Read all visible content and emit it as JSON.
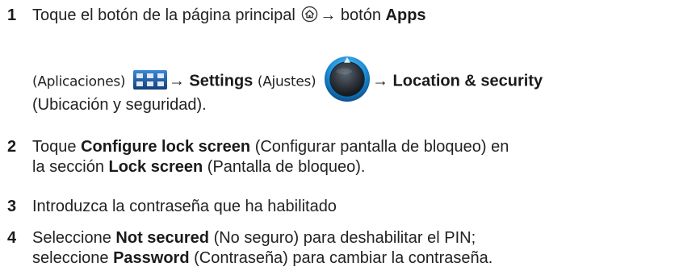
{
  "steps": [
    {
      "number": "1",
      "line1": {
        "a": "Toque el botón de la página principal",
        "arrow1": "→ botón",
        "apps": "Apps"
      },
      "line2": {
        "apps_paren": "(Aplicaciones)",
        "arrow2": "→",
        "settings": "Settings",
        "settings_paren": "(Ajustes)",
        "arrow3": "→",
        "location": "Location & security"
      },
      "line3": "(Ubicación y seguridad)."
    },
    {
      "number": "2",
      "line1": {
        "a": "Toque",
        "configure": "Configure lock screen",
        "b": "(Configurar pantalla de bloqueo) en"
      },
      "line2": {
        "a": "la sección",
        "lock": "Lock screen",
        "b": "(Pantalla de bloqueo)."
      }
    },
    {
      "number": "3",
      "line1": "Introduzca la contraseña que ha habilitado"
    },
    {
      "number": "4",
      "line1": {
        "a": "Seleccione",
        "notsecured": "Not secured",
        "b": "(No seguro) para deshabilitar el PIN;"
      },
      "line2": {
        "a": "seleccione",
        "password": "Password",
        "b": "(Contraseña) para cambiar la contraseña."
      }
    }
  ],
  "icons": {
    "home": "home-button-icon",
    "apps": "apps-grid-icon",
    "settings": "settings-dial-icon"
  },
  "colors": {
    "text": "#222222",
    "apps_icon_blue": "#1f5fb0",
    "settings_icon_blue": "#1e90d8"
  }
}
